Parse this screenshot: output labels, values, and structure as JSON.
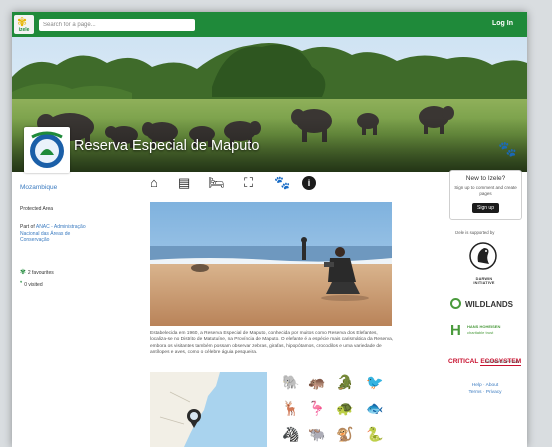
{
  "header": {
    "logo_text": "izele",
    "search_placeholder": "Search for a page...",
    "login_label": "Log In"
  },
  "banner": {
    "title": "Reserva Especial de Maputo",
    "logo_text": "RESERVA ESPECIAL DE MAPUTO"
  },
  "sidebar": {
    "country": "Mozambique",
    "protected_area": "Protected Area",
    "part_of_label": "Part of",
    "part_of_link": "ANAC - Administração Nacional das Áreas de Conservação",
    "favourites": "2 favourites",
    "visited": "0 visited"
  },
  "icon_row": [
    "home-icon",
    "newspaper-icon",
    "bed-icon",
    "map-icon",
    "paw-icon",
    "info-icon"
  ],
  "info_glyph": "i",
  "description": "Estabelecida em 1960, a Reserva Especial de Maputo, conhecida por muitos como Reserva dos Elefantes, localiza-se no Distrito de Matutuíne, na Província de Maputo. O elefante é a espécie mais carismática da Reserva, embora os visitantes também possam observar zebras, girafas, hipopótamos, crocodilos e uma variedade de antílopes e aves, como o célebre águia pesqueira.",
  "new_box": {
    "heading": "New to Izele?",
    "text": "Sign up to comment and create pages",
    "button": "Sign up"
  },
  "supporters": {
    "label": "Izele is supported by",
    "darwin": "DARWIN INITIATIVE",
    "wildlands": "WILDLANDS",
    "hans_line1": "HANS HOHEISEN",
    "hans_line2": "charitable trust",
    "cepf_a": "CRITICAL",
    "cepf_b": "ECOSYSTEM",
    "cepf_c": "PARTNERSHIP FUND"
  },
  "footer": {
    "help": "Help",
    "about": "About",
    "terms": "Terms",
    "privacy": "Privacy",
    "sep": "·"
  },
  "colors": {
    "brand_green": "#1f8a3a",
    "link_blue": "#3b7bc0",
    "cepf_red": "#c8102e"
  }
}
